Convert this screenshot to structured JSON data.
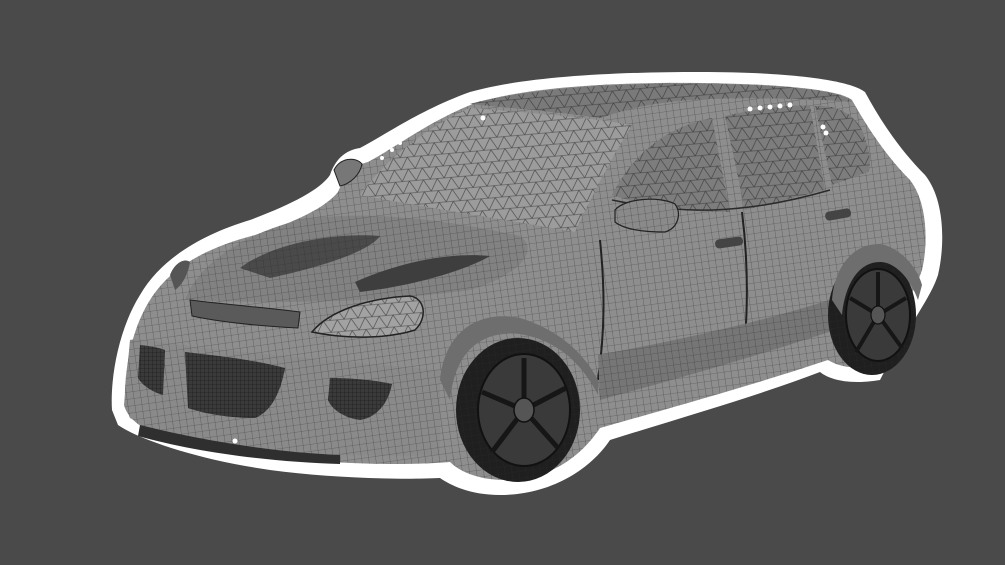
{
  "scene": {
    "subject": "wireframe-suv-render",
    "colors": {
      "background": "#4a4a4a",
      "outline": "#ffffff",
      "body": "#8e8e8e",
      "body_dark": "#6a6a6a",
      "glass": "#9a9a9a",
      "mesh": "#2c2c2c",
      "tire": "#1f1f1f",
      "rim": "#3a3a3a"
    }
  }
}
